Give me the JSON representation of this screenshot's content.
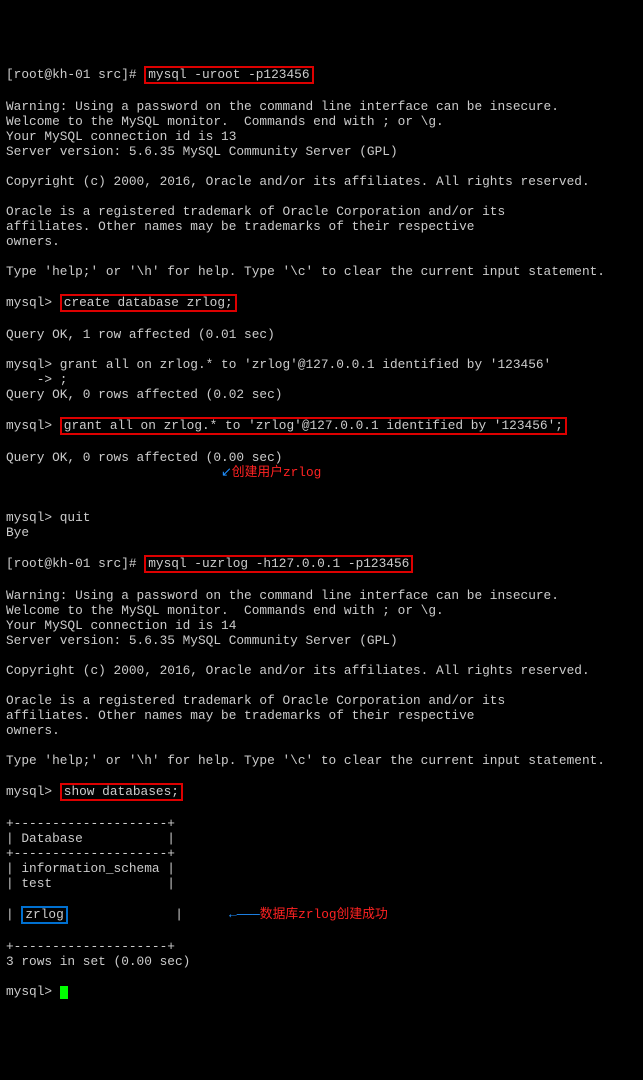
{
  "p1": "[root@kh-01 src]# ",
  "c1": "mysql -uroot -p123456",
  "b1": "Warning: Using a password on the command line interface can be insecure.\nWelcome to the MySQL monitor.  Commands end with ; or \\g.\nYour MySQL connection id is 13\nServer version: 5.6.35 MySQL Community Server (GPL)\n\nCopyright (c) 2000, 2016, Oracle and/or its affiliates. All rights reserved.\n\nOracle is a registered trademark of Oracle Corporation and/or its\naffiliates. Other names may be trademarks of their respective\nowners.\n\nType 'help;' or '\\h' for help. Type '\\c' to clear the current input statement.\n",
  "p2": "mysql> ",
  "c2": "create database zrlog;",
  "b2": "Query OK, 1 row affected (0.01 sec)\n\nmysql> grant all on zrlog.* to 'zrlog'@127.0.0.1 identified by '123456'\n    -> ;\nQuery OK, 0 rows affected (0.02 sec)\n",
  "p3": "mysql> ",
  "c3": "grant all on zrlog.* to 'zrlog'@127.0.0.1 identified by '123456';",
  "b3": "Query OK, 0 rows affected (0.00 sec)",
  "annot1": "创建用户zrlog",
  "b4": "\nmysql> quit\nBye",
  "p4": "[root@kh-01 src]# ",
  "c4": "mysql -uzrlog -h127.0.0.1 -p123456",
  "b5": "Warning: Using a password on the command line interface can be insecure.\nWelcome to the MySQL monitor.  Commands end with ; or \\g.\nYour MySQL connection id is 14\nServer version: 5.6.35 MySQL Community Server (GPL)\n\nCopyright (c) 2000, 2016, Oracle and/or its affiliates. All rights reserved.\n\nOracle is a registered trademark of Oracle Corporation and/or its\naffiliates. Other names may be trademarks of their respective\nowners.\n\nType 'help;' or '\\h' for help. Type '\\c' to clear the current input statement.\n",
  "p5": "mysql> ",
  "c5": "show databases;",
  "b6": "+--------------------+\n| Database           |\n+--------------------+\n| information_schema |\n| test               |",
  "b7pre": "| ",
  "zrlog": "zrlog",
  "b7post": "              |      ",
  "annot2": "数据库zrlog创建成功",
  "b8": "+--------------------+\n3 rows in set (0.00 sec)\n",
  "p6": "mysql> "
}
